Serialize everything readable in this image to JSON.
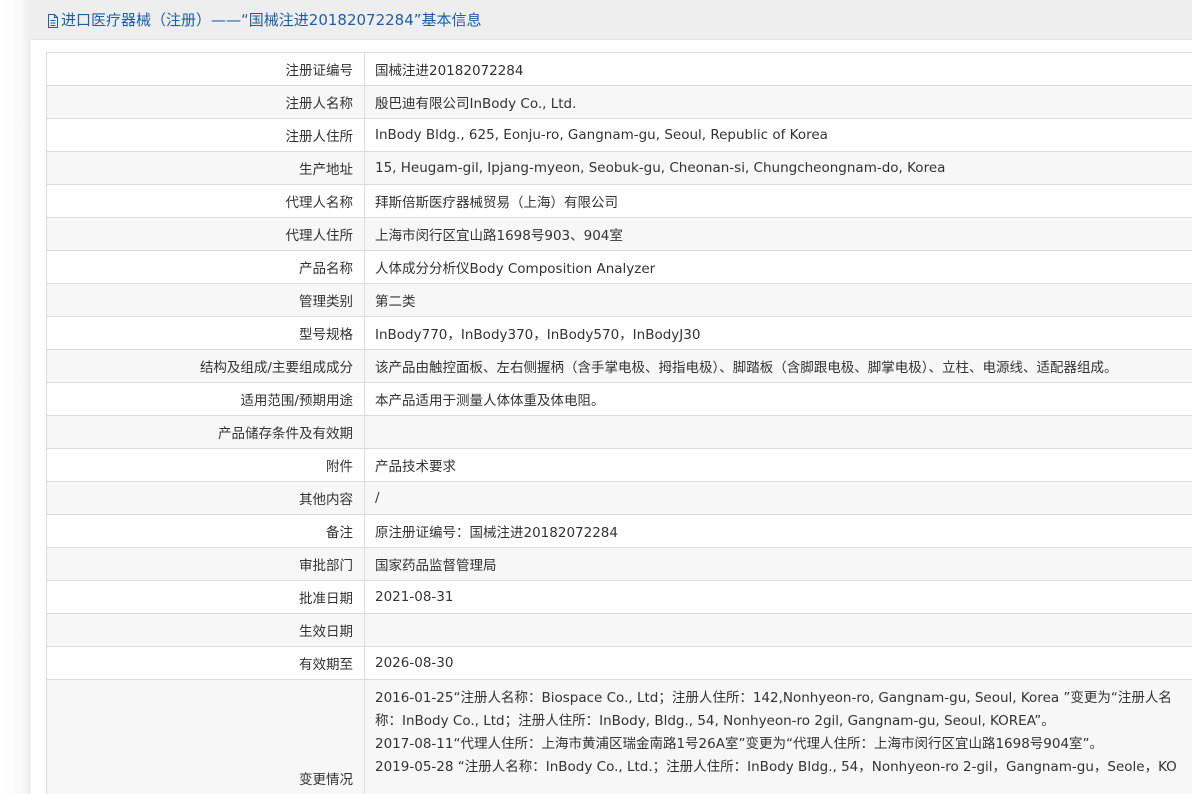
{
  "header": {
    "title": "进口医疗器械（注册）——“国械注进20182072284”基本信息"
  },
  "rows": [
    {
      "label": "注册证编号",
      "value": "国械注进20182072284"
    },
    {
      "label": "注册人名称",
      "value": "殷巴迪有限公司InBody Co., Ltd."
    },
    {
      "label": "注册人住所",
      "value": "InBody Bldg., 625, Eonju-ro, Gangnam-gu, Seoul, Republic of Korea"
    },
    {
      "label": "生产地址",
      "value": "15, Heugam-gil, Ipjang-myeon, Seobuk-gu, Cheonan-si, Chungcheongnam-do, Korea"
    },
    {
      "label": "代理人名称",
      "value": "拜斯倍斯医疗器械贸易（上海）有限公司"
    },
    {
      "label": "代理人住所",
      "value": "上海市闵行区宜山路1698号903、904室"
    },
    {
      "label": "产品名称",
      "value": "人体成分分析仪Body Composition Analyzer"
    },
    {
      "label": "管理类别",
      "value": "第二类"
    },
    {
      "label": "型号规格",
      "value": "InBody770，InBody370，InBody570，InBodyJ30"
    },
    {
      "label": "结构及组成/主要组成成分",
      "value": "该产品由触控面板、左右侧握柄（含手掌电极、拇指电极）、脚踏板（含脚跟电极、脚掌电极）、立柱、电源线、适配器组成。"
    },
    {
      "label": "适用范围/预期用途",
      "value": "本产品适用于测量人体体重及体电阻。"
    },
    {
      "label": "产品储存条件及有效期",
      "value": ""
    },
    {
      "label": "附件",
      "value": "产品技术要求"
    },
    {
      "label": "其他内容",
      "value": "/"
    },
    {
      "label": "备注",
      "value": "原注册证编号：国械注进20182072284"
    },
    {
      "label": "审批部门",
      "value": "国家药品监督管理局"
    },
    {
      "label": "批准日期",
      "value": "2021-08-31"
    },
    {
      "label": "生效日期",
      "value": ""
    },
    {
      "label": "有效期至",
      "value": "2026-08-30"
    }
  ],
  "change_row": {
    "label": "变更情况",
    "lines": [
      "2016-01-25“注册人名称：Biospace Co., Ltd；注册人住所：142,Nonhyeon-ro, Gangnam-gu, Seoul, Korea ”变更为“注册人名",
      "称：InBody Co., Ltd；注册人住所：InBody, Bldg., 54, Nonhyeon-ro 2gil, Gangnam-gu, Seoul, KOREA”。",
      "2017-08-11“代理人住所：上海市黄浦区瑞金南路1号26A室”变更为“代理人住所：上海市闵行区宜山路1698号904室”。",
      "2019-05-28 “注册人名称：InBody Co., Ltd.；注册人住所：InBody Bldg., 54，Nonhyeon-ro 2-gil，Gangnam-gu，Seole，KO"
    ]
  },
  "colors": {
    "title_text": "#1d5fa6",
    "title_bg": "#eeeeee",
    "border": "#dcdcdc",
    "alt_row_bg": "#f7f7f7",
    "text": "#333333"
  },
  "icons": {
    "title_icon": "document-icon"
  }
}
